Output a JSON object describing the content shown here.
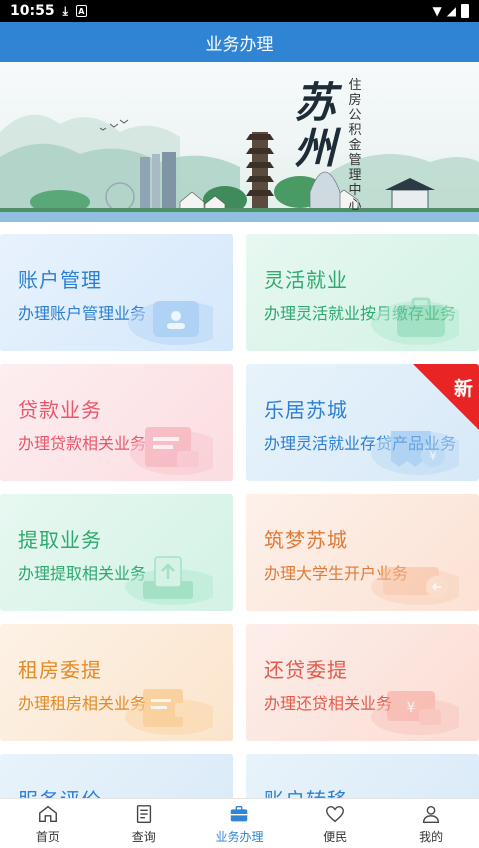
{
  "status_bar": {
    "time": "10:55"
  },
  "header": {
    "title": "业务办理"
  },
  "banner": {
    "city_name": "苏州",
    "subtitle_chars": [
      "住",
      "房",
      "公",
      "积",
      "金",
      "管",
      "理",
      "中",
      "心"
    ]
  },
  "cards": [
    {
      "title": "账户管理",
      "desc": "办理账户管理业务"
    },
    {
      "title": "灵活就业",
      "desc": "办理灵活就业按月缴存业务"
    },
    {
      "title": "贷款业务",
      "desc": "办理贷款相关业务"
    },
    {
      "title": "乐居苏城",
      "desc": "办理灵活就业存贷产品业务",
      "badge": "新"
    },
    {
      "title": "提取业务",
      "desc": "办理提取相关业务"
    },
    {
      "title": "筑梦苏城",
      "desc": "办理大学生开户业务"
    },
    {
      "title": "租房委提",
      "desc": "办理租房相关业务"
    },
    {
      "title": "还贷委提",
      "desc": "办理还贷相关业务"
    },
    {
      "title": "服务评价"
    },
    {
      "title": "账户转移"
    }
  ],
  "bottom_nav": [
    {
      "label": "首页"
    },
    {
      "label": "查询"
    },
    {
      "label": "业务办理"
    },
    {
      "label": "便民"
    },
    {
      "label": "我的"
    }
  ],
  "colors": {
    "brand_blue": "#2f84d4",
    "badge_red": "#e82424"
  }
}
